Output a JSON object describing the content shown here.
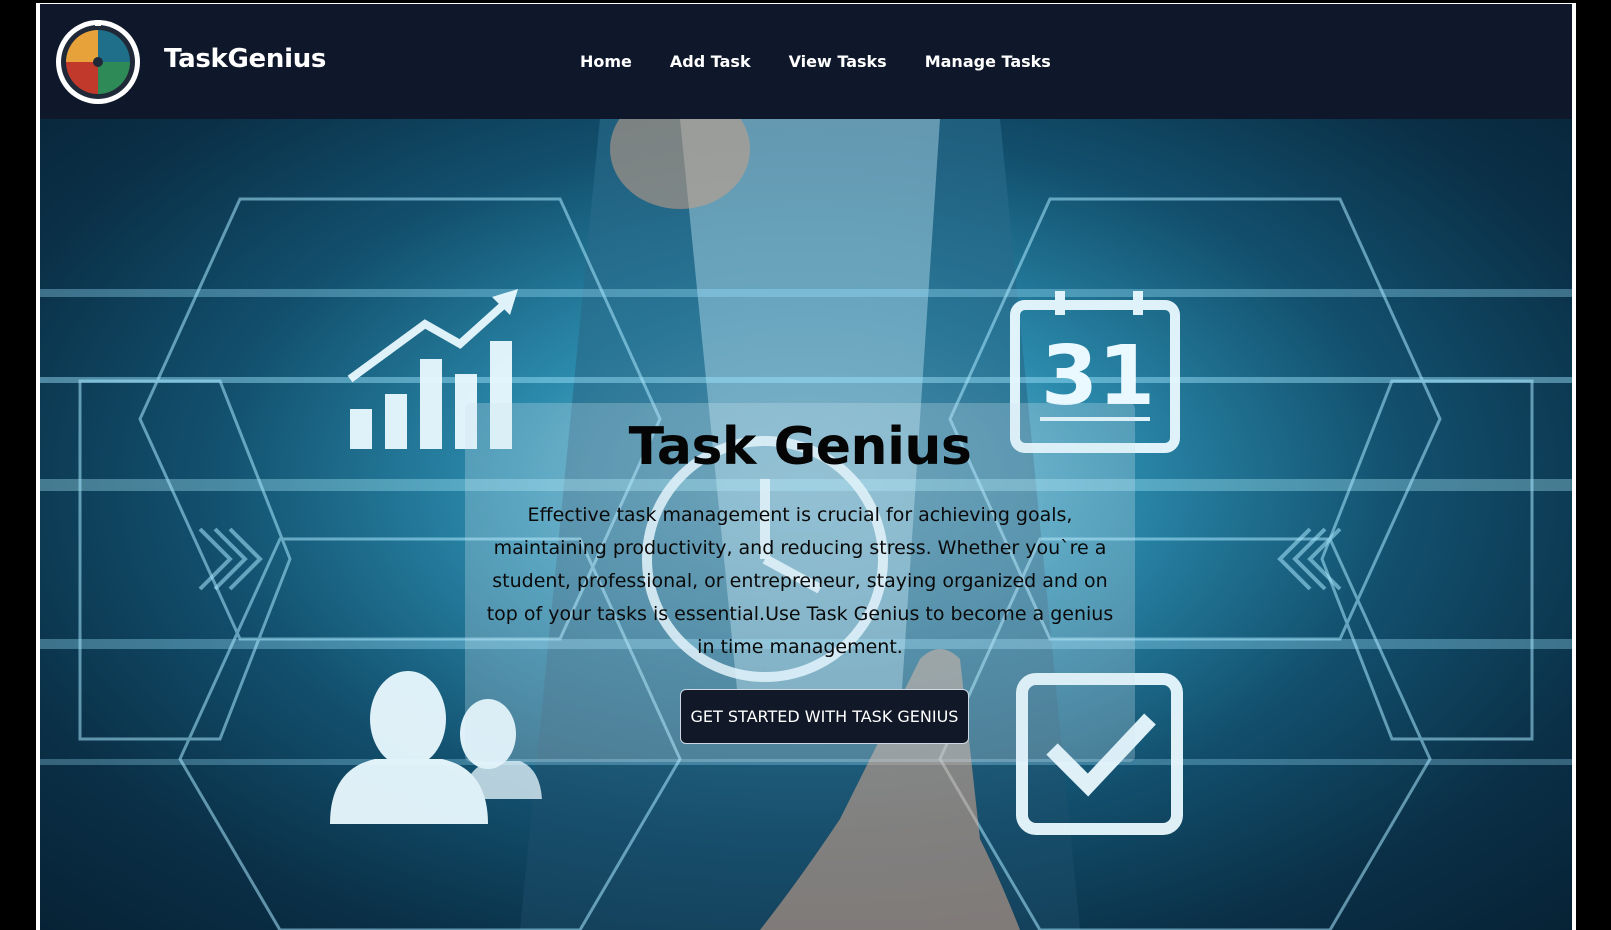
{
  "brand": {
    "name": "TaskGenius",
    "logo_icon": "taskgenius-logo-icon"
  },
  "nav": {
    "items": [
      {
        "label": "Home"
      },
      {
        "label": "Add Task"
      },
      {
        "label": "View Tasks"
      },
      {
        "label": "Manage Tasks"
      }
    ]
  },
  "hero": {
    "title": "Task Genius",
    "description": "Effective task management is crucial for achieving goals, maintaining productivity, and reducing stress. Whether you`re a student, professional, or entrepreneur, staying organized and on top of your tasks is essential.Use Task Genius to become a genius in time management.",
    "cta_label": "GET STARTED WITH TASK GENIUS",
    "calendar_day": "31"
  },
  "colors": {
    "navbar_bg": "#0f172a",
    "cta_bg": "#111827",
    "hero_accent": "#7cc8e0"
  }
}
